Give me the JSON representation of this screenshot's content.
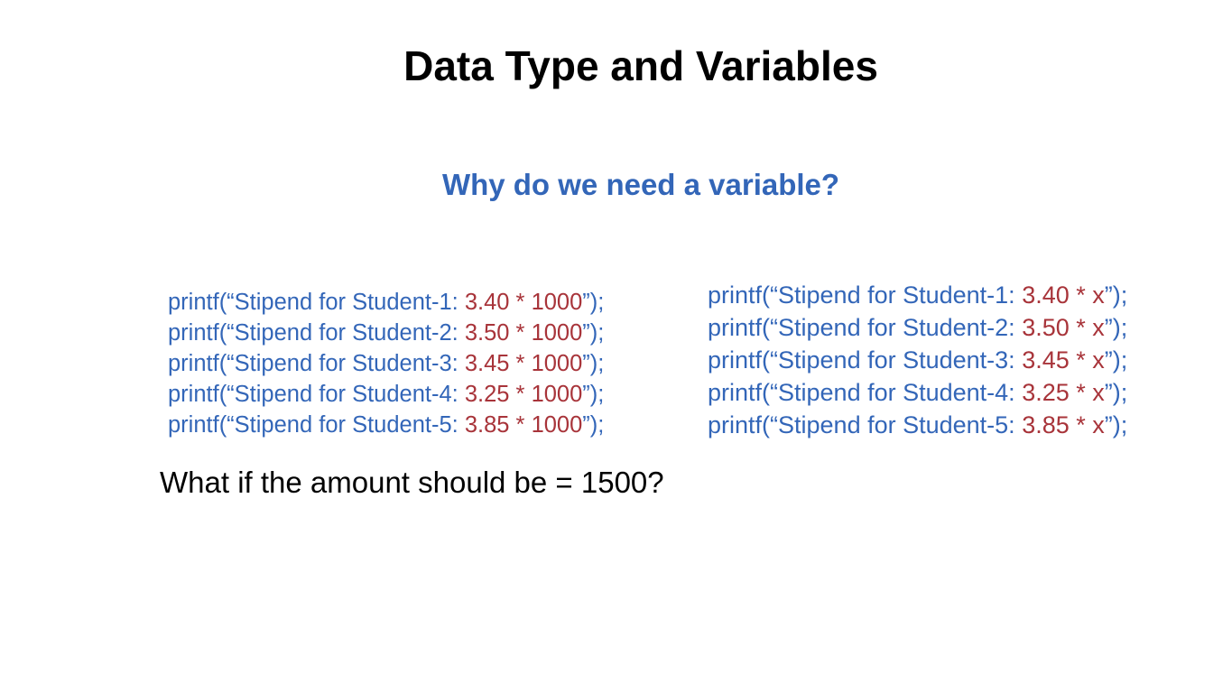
{
  "colors": {
    "blue": "#3366b8",
    "red": "#a8343a"
  },
  "slide": {
    "title": "Data Type and Variables",
    "subtitle": "Why do we need a variable?",
    "question": "What if the amount should be = 1500?"
  },
  "left_code": [
    {
      "text": "printf(“Stipend for Student-1: ",
      "value": "3.40 * 1000",
      "suffix": "”);"
    },
    {
      "text": "printf(“Stipend for Student-2: ",
      "value": "3.50 * 1000",
      "suffix": "”);"
    },
    {
      "text": "printf(“Stipend for Student-3: ",
      "value": "3.45 * 1000",
      "suffix": "”);"
    },
    {
      "text": "printf(“Stipend for Student-4: ",
      "value": "3.25 * 1000",
      "suffix": "”);"
    },
    {
      "text": "printf(“Stipend for Student-5: ",
      "value": "3.85 * 1000",
      "suffix": "”);"
    }
  ],
  "right_code": [
    {
      "text": "printf(“Stipend for Student-1: ",
      "value": "3.40 * x",
      "suffix": "”);"
    },
    {
      "text": "printf(“Stipend for Student-2: ",
      "value": "3.50 * x",
      "suffix": "”);"
    },
    {
      "text": "printf(“Stipend for Student-3: ",
      "value": "3.45 * x",
      "suffix": "”);"
    },
    {
      "text": "printf(“Stipend for Student-4: ",
      "value": "3.25 * x",
      "suffix": "”);"
    },
    {
      "text": "printf(“Stipend for Student-5: ",
      "value": "3.85 * x",
      "suffix": "”);"
    }
  ]
}
